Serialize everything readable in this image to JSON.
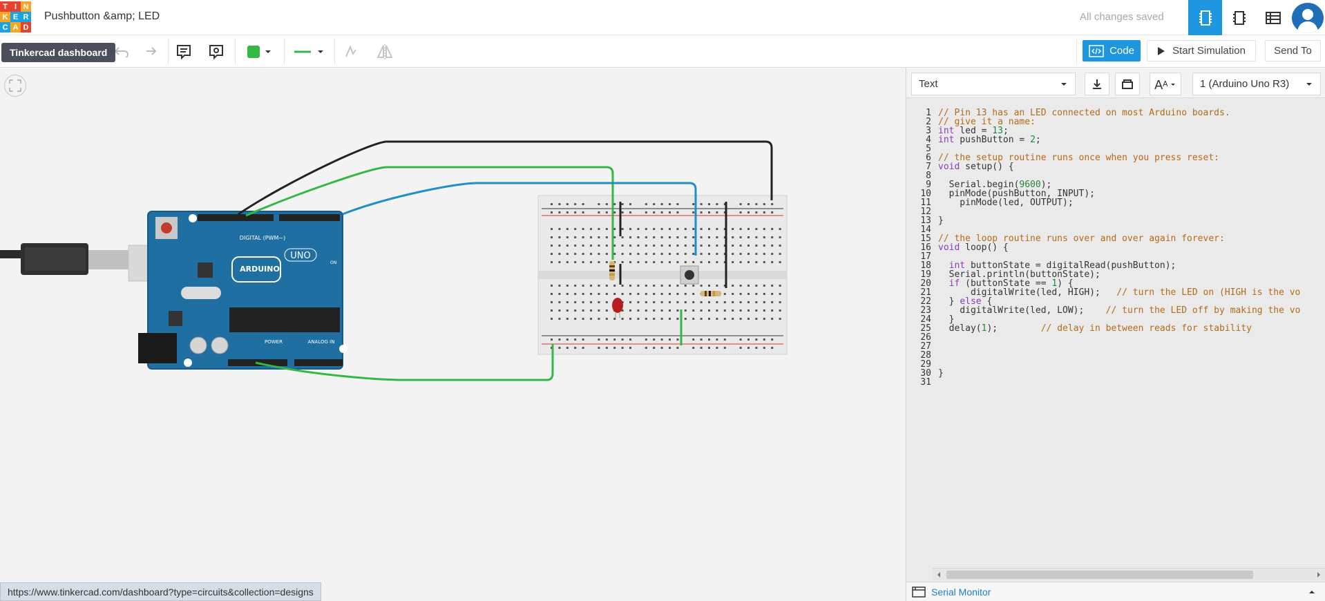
{
  "app": {
    "logo_letters": [
      "T",
      "I",
      "N",
      "K",
      "E",
      "R",
      "C",
      "A",
      "D"
    ],
    "logo_colors": [
      "#e8412d",
      "#e8412d",
      "#f6a623",
      "#f6a623",
      "#1aa3e0",
      "#1aa3e0",
      "#1aa3e0",
      "#f6a623",
      "#e8412d"
    ],
    "project_title": "Pushbutton &amp; LED",
    "save_status": "All changes saved",
    "tooltip": "Tinkercad dashboard",
    "accent": "#1e96e0"
  },
  "views": [
    "circuit-view-icon",
    "schematic-view-icon",
    "component-list-icon"
  ],
  "toolbar": {
    "color_swatch": "#33b843",
    "wire_color": "#33b843",
    "code_label": "Code",
    "simulate_label": "Start Simulation",
    "send_label": "Send To"
  },
  "status_url": "https://www.tinkercad.com/dashboard?type=circuits&collection=designs",
  "code_panel": {
    "mode": "Text",
    "device": "1 (Arduino Uno R3)",
    "serial_monitor": "Serial Monitor",
    "lines": [
      "// Pin 13 has an LED connected on most Arduino boards.",
      "// give it a name:",
      "int led = 13;",
      "int pushButton = 2;",
      "",
      "// the setup routine runs once when you press reset:",
      "void setup() {",
      "",
      "  Serial.begin(9600);",
      "  pinMode(pushButton, INPUT);",
      "    pinMode(led, OUTPUT);",
      "",
      "}",
      "",
      "// the loop routine runs over and over again forever:",
      "void loop() {",
      "",
      "  int buttonState = digitalRead(pushButton);",
      "  Serial.println(buttonState);",
      "  if (buttonState == 1) {",
      "      digitalWrite(led, HIGH);   // turn the LED on (HIGH is the vo",
      "  } else {",
      "    digitalWrite(led, LOW);    // turn the LED off by making the vo",
      "  }",
      "  delay(1);        // delay in between reads for stability",
      "",
      "",
      "",
      "",
      "}",
      ""
    ]
  },
  "board": {
    "brand": "ARDUINO",
    "model": "UNO",
    "digital_label": "DIGITAL (PWM~)",
    "power_label": "POWER",
    "analog_label": "ANALOG IN",
    "on_label": "ON"
  }
}
